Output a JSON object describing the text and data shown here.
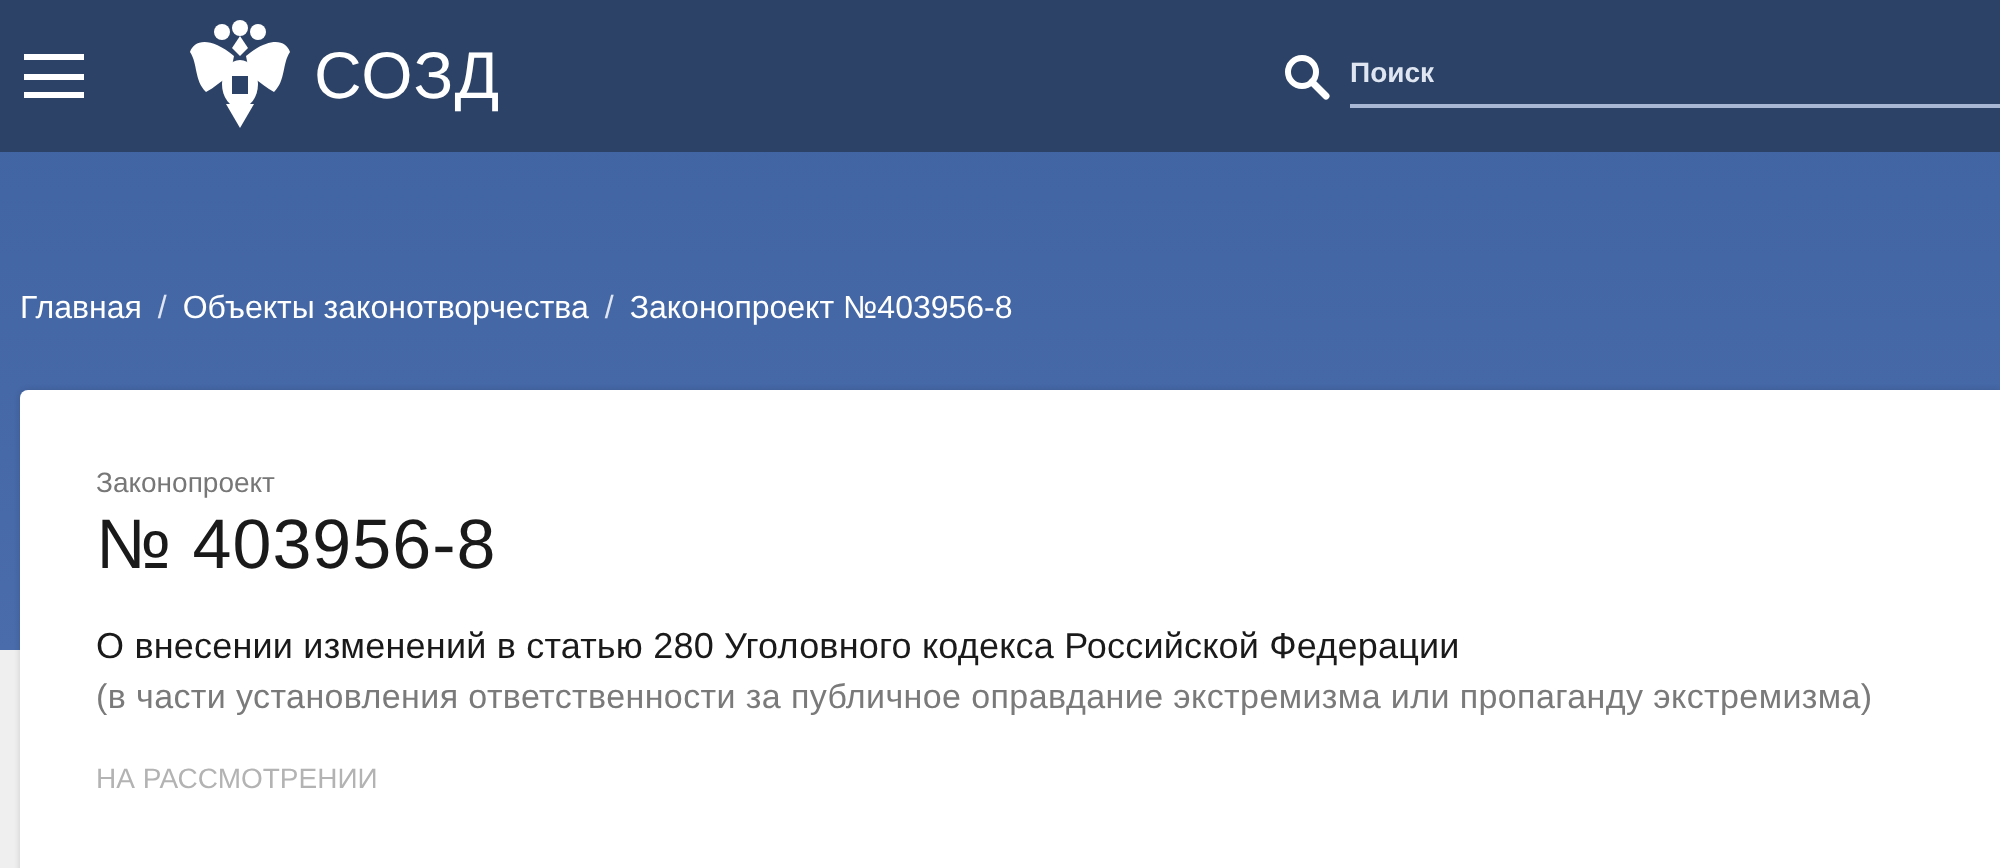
{
  "header": {
    "logo_text": "СОЗД",
    "search": {
      "placeholder": "Поиск"
    }
  },
  "breadcrumbs": [
    {
      "label": "Главная"
    },
    {
      "separator": "/",
      "label": "Объекты законотворчества"
    },
    {
      "separator": "/",
      "label": "Законопроект №403956-8"
    }
  ],
  "bill": {
    "type_label": "Законопроект",
    "number": "№ 403956-8",
    "title": "О внесении изменений в статью 280 Уголовного кодекса Российской Федерации",
    "subtitle": "(в части установления ответственности за публичное оправдание экстремизма или пропаганду экстремизма)",
    "status": "НА РАССМОТРЕНИИ"
  }
}
